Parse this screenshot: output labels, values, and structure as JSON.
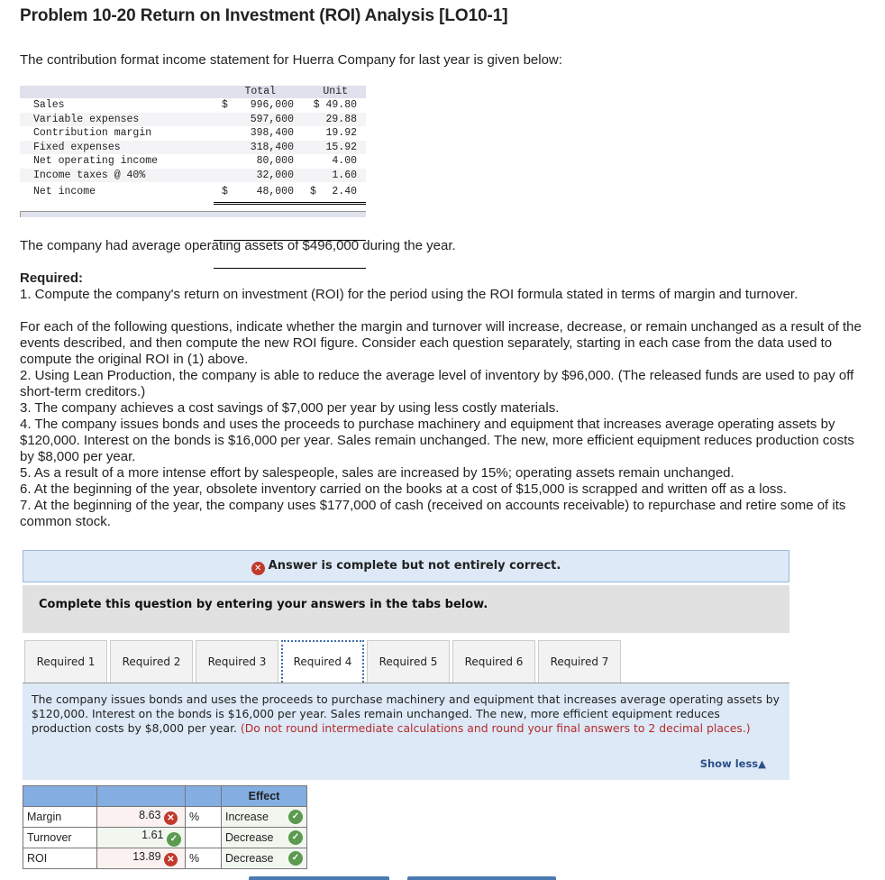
{
  "title": "Problem 10-20 Return on Investment (ROI) Analysis [LO10-1]",
  "intro": "The contribution format income statement for Huerra Company for last year is given below:",
  "statement": {
    "header": {
      "total": "Total",
      "unit": "Unit"
    },
    "rows": [
      {
        "label": "Sales",
        "d1": "$",
        "total": "996,000",
        "d2": "",
        "unit": "$ 49.80"
      },
      {
        "label": "Variable expenses",
        "d1": "",
        "total": "597,600",
        "d2": "",
        "unit": "29.88"
      },
      {
        "label": "Contribution margin",
        "d1": "",
        "total": "398,400",
        "d2": "",
        "unit": "19.92"
      },
      {
        "label": "Fixed expenses",
        "d1": "",
        "total": "318,400",
        "d2": "",
        "unit": "15.92"
      },
      {
        "label": "Net operating income",
        "d1": "",
        "total": "80,000",
        "d2": "",
        "unit": "4.00"
      },
      {
        "label": "Income taxes @ 40%",
        "d1": "",
        "total": "32,000",
        "d2": "",
        "unit": "1.60"
      },
      {
        "label": "Net income",
        "d1": "$",
        "total": "48,000",
        "d2": "$",
        "unit": "2.40"
      }
    ]
  },
  "assets_text": "The company had average operating assets of $496,000 during the year.",
  "required_heading": "Required:",
  "req1": "1. Compute the company's return on investment (ROI) for the period using the ROI formula stated in terms of margin and turnover.",
  "instructions": "For each of the following questions, indicate whether the margin and turnover will increase, decrease, or remain unchanged as a result of the events described, and then compute the new ROI figure. Consider each question separately, starting in each case from the data used to compute the original ROI in (1) above.",
  "items": [
    "2. Using Lean Production, the company is able to reduce the average level of inventory by $96,000. (The released funds are used to pay off short-term creditors.)",
    "3. The company achieves a cost savings of $7,000 per year by using less costly materials.",
    "4. The company issues bonds and uses the proceeds to purchase machinery and equipment that increases average operating assets by $120,000. Interest on the bonds is $16,000 per year. Sales remain unchanged. The new, more efficient equipment reduces production costs by $8,000 per year.",
    "5. As a result of a more intense effort by salespeople, sales are increased by 15%; operating assets remain unchanged.",
    "6. At the beginning of the year, obsolete inventory carried on the books at a cost of $15,000 is scrapped and written off as a loss.",
    "7. At the beginning of the year, the company uses $177,000 of cash (received on accounts receivable) to repurchase and retire some of its common stock."
  ],
  "feedback": {
    "icon": "x-circle-icon",
    "text": "Answer is complete but not entirely correct."
  },
  "tab_instruction": "Complete this question by entering your answers in the tabs below.",
  "tabs": [
    "Required 1",
    "Required 2",
    "Required 3",
    "Required 4",
    "Required 5",
    "Required 6",
    "Required 7"
  ],
  "active_tab": "Required 4",
  "question": {
    "text": "The company issues bonds and uses the proceeds to purchase machinery and equipment that increases average operating assets by $120,000. Interest on the bonds is $16,000 per year. Sales remain unchanged. The new, more efficient equipment reduces production costs by $8,000 per year.",
    "note": "(Do not round  intermediate calculations and round your final answers to 2 decimal places.)",
    "show_less": "Show less"
  },
  "answer_table": {
    "effect_header": "Effect",
    "rows": [
      {
        "label": "Margin",
        "value": "8.63",
        "value_status": "incorrect",
        "unit": "%",
        "effect": "Increase",
        "effect_status": "correct"
      },
      {
        "label": "Turnover",
        "value": "1.61",
        "value_status": "correct",
        "unit": "",
        "effect": "Decrease",
        "effect_status": "correct"
      },
      {
        "label": "ROI",
        "value": "13.89",
        "value_status": "incorrect",
        "unit": "%",
        "effect": "Decrease",
        "effect_status": "correct"
      }
    ]
  },
  "colors": {
    "correct": "#5b9a4f",
    "incorrect": "#c0392b",
    "accent": "#84aee2",
    "note_red": "#b42a2a",
    "link": "#2c4f8a"
  }
}
